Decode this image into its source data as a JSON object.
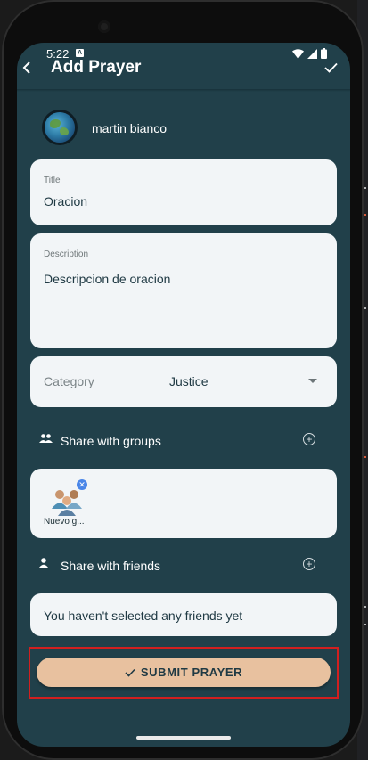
{
  "status_bar": {
    "time": "5:22",
    "notification_badge": "A"
  },
  "app_bar": {
    "back_icon": "back-arrow-icon",
    "title": "Add Prayer",
    "confirm_icon": "check-icon"
  },
  "user": {
    "name": "martin bianco",
    "avatar_icon": "globe-avatar"
  },
  "title_field": {
    "label": "Title",
    "value": "Oracion"
  },
  "description_field": {
    "label": "Description",
    "value": "Descripcion de oracion"
  },
  "category": {
    "label": "Category",
    "value": "Justice"
  },
  "share_groups": {
    "label": "Share with groups",
    "groups": [
      {
        "name": "Nuevo g..."
      }
    ]
  },
  "share_friends": {
    "label": "Share with friends",
    "empty_text": "You haven't selected any friends yet"
  },
  "submit": {
    "label": "SUBMIT PRAYER"
  },
  "colors": {
    "background": "#21404a",
    "card": "#f2f5f7",
    "submit": "#e8c19f",
    "highlight": "#d21f1f",
    "chip_close": "#4a86e8"
  }
}
